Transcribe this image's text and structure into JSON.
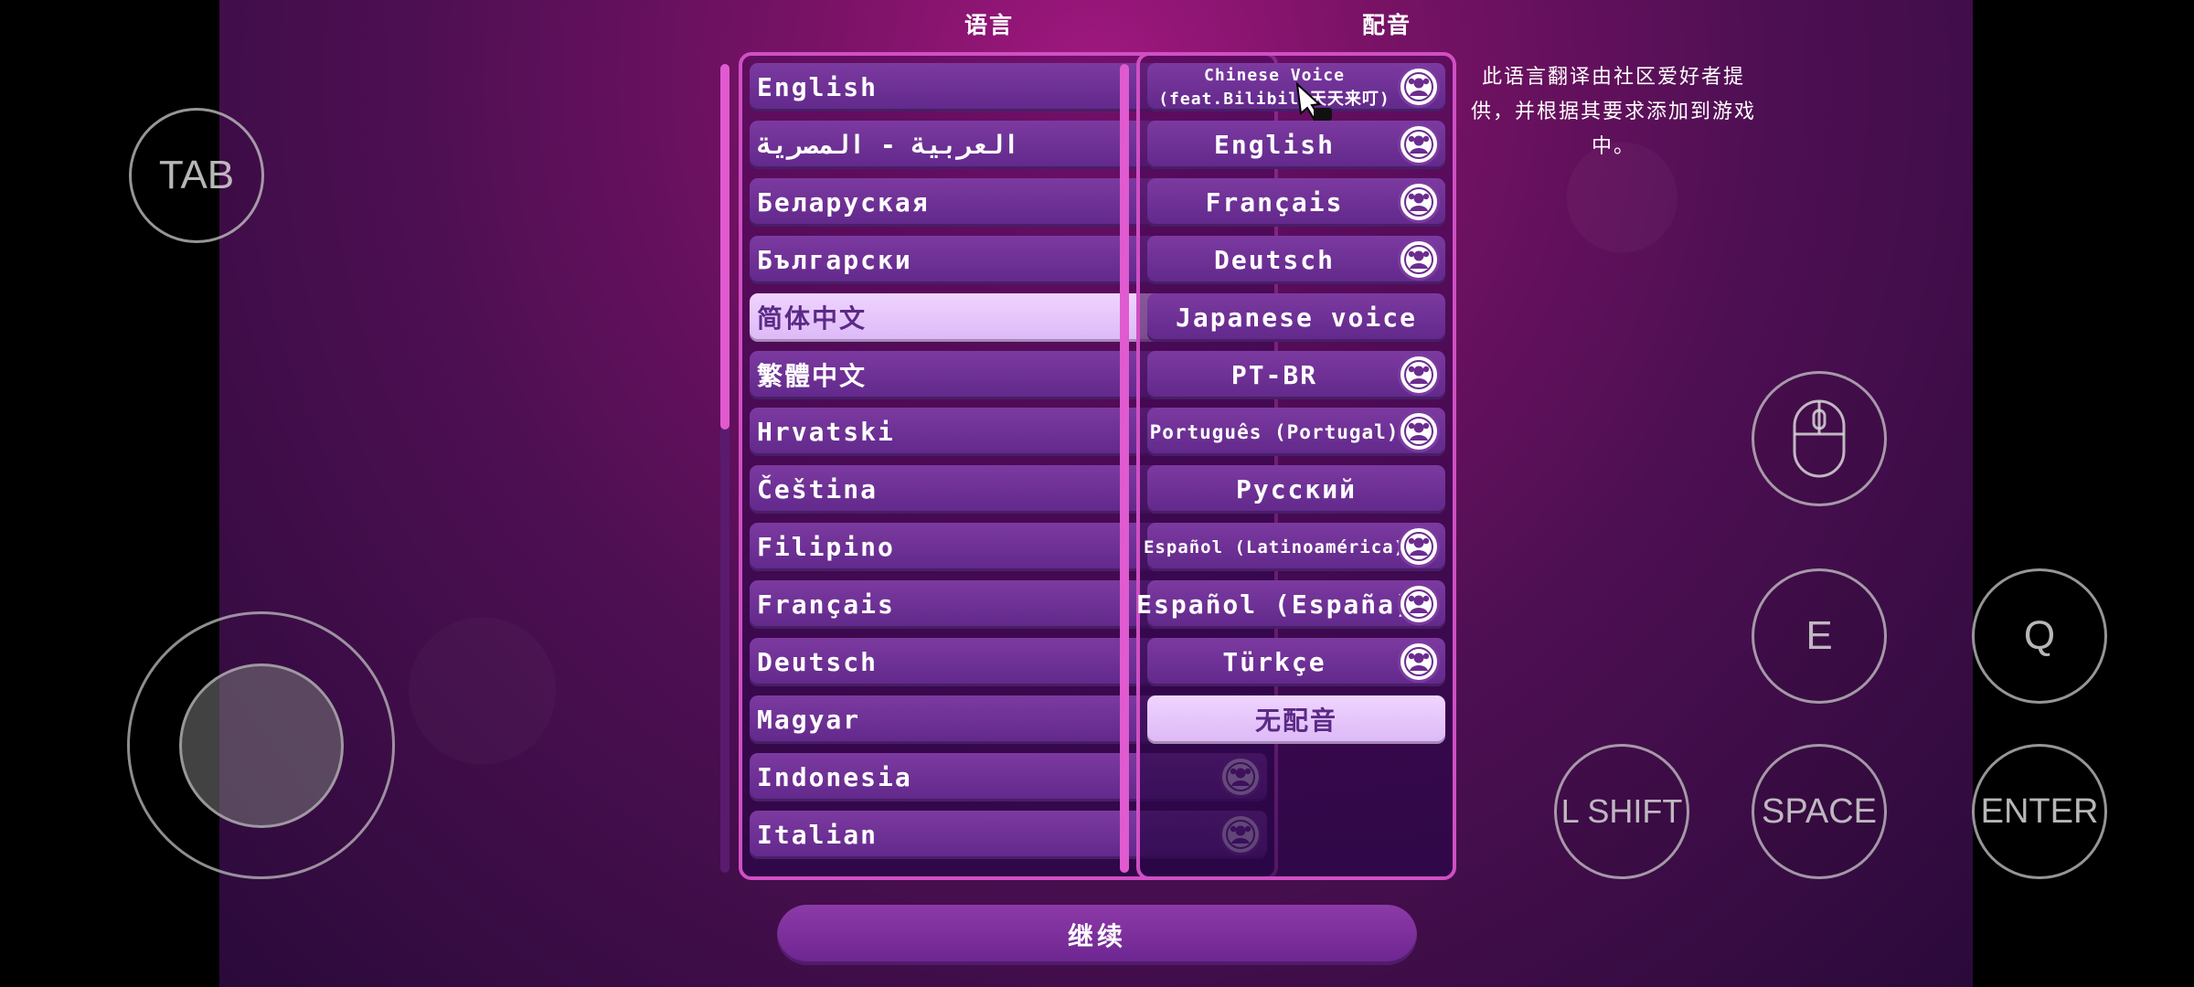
{
  "headers": {
    "language": "语言",
    "voice": "配音"
  },
  "languages": [
    {
      "label": "English",
      "icon": false,
      "selected": false
    },
    {
      "label": "العربية - المصرية",
      "icon": true,
      "selected": false
    },
    {
      "label": "Беларуская",
      "icon": true,
      "selected": false
    },
    {
      "label": "Български",
      "icon": true,
      "selected": false
    },
    {
      "label": "简体中文",
      "icon": false,
      "selected": true
    },
    {
      "label": "繁體中文",
      "icon": true,
      "selected": false
    },
    {
      "label": "Hrvatski",
      "icon": true,
      "selected": false
    },
    {
      "label": "Čeština",
      "icon": true,
      "selected": false
    },
    {
      "label": "Filipino",
      "icon": true,
      "selected": false
    },
    {
      "label": "Français",
      "icon": false,
      "selected": false
    },
    {
      "label": "Deutsch",
      "icon": false,
      "selected": false
    },
    {
      "label": "Magyar",
      "icon": true,
      "selected": false
    },
    {
      "label": "Indonesia",
      "icon": true,
      "selected": false
    },
    {
      "label": "Italian",
      "icon": true,
      "selected": false
    }
  ],
  "voices": [
    {
      "label": "Chinese Voice",
      "label2": "(feat.Bilibili天天来叮)",
      "icon": true,
      "selected": false,
      "size": "twoline"
    },
    {
      "label": "English",
      "icon": true,
      "selected": false
    },
    {
      "label": "Français",
      "icon": true,
      "selected": false
    },
    {
      "label": "Deutsch",
      "icon": true,
      "selected": false
    },
    {
      "label": "Japanese voice",
      "icon": false,
      "selected": false
    },
    {
      "label": "PT-BR",
      "icon": true,
      "selected": false
    },
    {
      "label": "Português (Portugal)",
      "icon": true,
      "selected": false,
      "size": "small"
    },
    {
      "label": "Русский",
      "icon": false,
      "selected": false
    },
    {
      "label": "Español (Latinoamérica)",
      "icon": true,
      "selected": false,
      "size": "tiny"
    },
    {
      "label": "Español (España)",
      "icon": true,
      "selected": false
    },
    {
      "label": "Türkçe",
      "icon": true,
      "selected": false
    },
    {
      "label": "无配音",
      "icon": false,
      "selected": true
    }
  ],
  "note": "此语言翻译由社区爱好者提供，并根据其要求添加到游戏中。",
  "continue_label": "继续",
  "controls": {
    "tab": "TAB",
    "e": "E",
    "q": "Q",
    "lshift": "L SHIFT",
    "space": "SPACE",
    "enter": "ENTER"
  },
  "colors": {
    "panel_border": "#d04fc4",
    "item_bg": "#7c3aa0",
    "item_selected_bg": "#f0d4ff"
  }
}
